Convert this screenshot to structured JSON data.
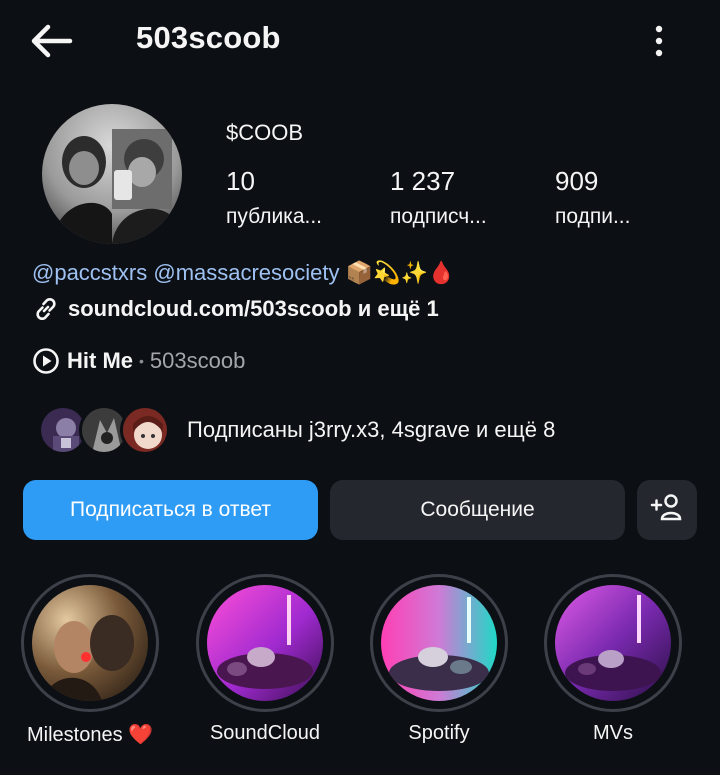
{
  "header": {
    "username": "503scoob"
  },
  "profile": {
    "display_name": "$COOB",
    "stats": [
      {
        "value": "10",
        "label": "публика..."
      },
      {
        "value": "1 237",
        "label": "подписч..."
      },
      {
        "value": "909",
        "label": "подпи..."
      }
    ],
    "bio_mentions": "@paccstxrs @massacresociety",
    "bio_emoji": "📦💫✨🩸",
    "link_text": "soundcloud.com/503scoob и ещё 1",
    "music": {
      "song": "Hit Me",
      "separator": "•",
      "artist": "503scoob"
    },
    "followed_by": "Подписаны j3rry.x3, 4sgrave и ещё 8"
  },
  "actions": {
    "follow_back": "Подписаться в ответ",
    "message": "Сообщение"
  },
  "highlights": [
    {
      "label": "Milestones ❤️"
    },
    {
      "label": "SoundCloud"
    },
    {
      "label": "Spotify"
    },
    {
      "label": "MVs"
    }
  ],
  "colors": {
    "background": "#0c0f14",
    "primary_button": "#2e9bf5",
    "secondary_button": "#24272d",
    "mention": "#9ec1f2"
  }
}
